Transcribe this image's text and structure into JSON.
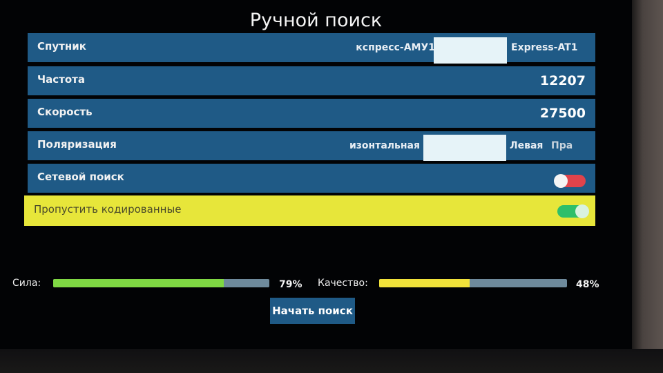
{
  "screen": {
    "title": "Ручной поиск"
  },
  "satellite": {
    "label": "Спутник",
    "option_left": "кспресс-АМУ1",
    "option_selected": "",
    "option_right": "Express-AT1"
  },
  "frequency": {
    "label": "Частота",
    "value": "12207"
  },
  "symbol_rate": {
    "label": "Скорость",
    "value": "27500"
  },
  "polarization": {
    "label": "Поляризация",
    "option_left": "изонтальная",
    "option_selected": "",
    "option_right": "Левая",
    "option_far_right": "Пра"
  },
  "network_search": {
    "label": "Сетевой поиск",
    "enabled": false
  },
  "skip_encrypted": {
    "label": "Пропустить кодированные",
    "enabled": true
  },
  "signal": {
    "strength_label": "Сила:",
    "strength_value": "79%",
    "strength_percent": 79,
    "quality_label": "Качество:",
    "quality_value": "48%",
    "quality_percent": 48
  },
  "actions": {
    "start_label": "Начать поиск"
  },
  "colors": {
    "row_bg": "#1f5a86",
    "selected_row_bg": "#e7e63a",
    "toggle_on": "#2ebf6a",
    "toggle_off": "#e0434b",
    "strength_fill": "#7fd843",
    "quality_fill": "#f1e23a"
  }
}
